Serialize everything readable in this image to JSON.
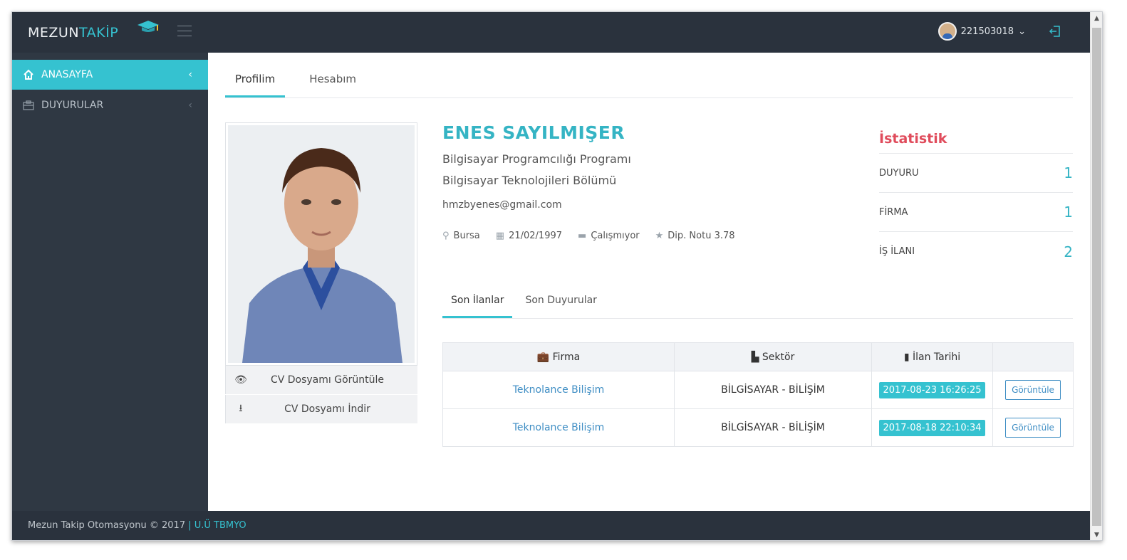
{
  "header": {
    "logo_part1": "MEZUN",
    "logo_part2": "TAKİP",
    "username": "221503018",
    "user_chevron": "⌄"
  },
  "sidebar": {
    "items": [
      {
        "label": "ANASAYFA",
        "icon": "home-icon",
        "chevron": "‹"
      },
      {
        "label": "DUYURULAR",
        "icon": "briefcase-icon",
        "chevron": "‹"
      }
    ]
  },
  "main_tabs": [
    {
      "label": "Profilim"
    },
    {
      "label": "Hesabım"
    }
  ],
  "profile": {
    "name": "ENES SAYILMIŞER",
    "program": "Bilgisayar Programcılığı Programı",
    "department": "Bilgisayar Teknolojileri Bölümü",
    "email": "hmzbyenes@gmail.com",
    "city": "Bursa",
    "birthdate": "21/02/1997",
    "work_status": "Çalışmıyor",
    "gpa": "Dip. Notu 3.78",
    "cv_view_label": "CV Dosyamı Görüntüle",
    "cv_download_label": "CV Dosyamı İndir"
  },
  "stats": {
    "title": "İstatistik",
    "rows": [
      {
        "label": "DUYURU",
        "value": "1"
      },
      {
        "label": "FİRMA",
        "value": "1"
      },
      {
        "label": "İŞ İLANI",
        "value": "2"
      }
    ]
  },
  "sub_tabs": [
    {
      "label": "Son İlanlar"
    },
    {
      "label": "Son Duyurular"
    }
  ],
  "table": {
    "headers": [
      "Firma",
      "Sektör",
      "İlan Tarihi",
      ""
    ],
    "rows": [
      {
        "firma": "Teknolance Bilişim",
        "sektor": "BİLGİSAYAR - BİLİŞİM",
        "tarih": "2017-08-23 16:26:25",
        "action": "Görüntüle"
      },
      {
        "firma": "Teknolance Bilişim",
        "sektor": "BİLGİSAYAR - BİLİŞİM",
        "tarih": "2017-08-18 22:10:34",
        "action": "Görüntüle"
      }
    ]
  },
  "footer": {
    "text": "Mezun Takip Otomasyonu © 2017",
    "separator": "|",
    "link": "U.Ü TBMYO"
  },
  "colors": {
    "accent": "#35c2d0",
    "header_bg": "#2a323d",
    "sidebar_bg": "#2f3843",
    "stats_title": "#e04c5c",
    "link": "#3f8ec4"
  }
}
